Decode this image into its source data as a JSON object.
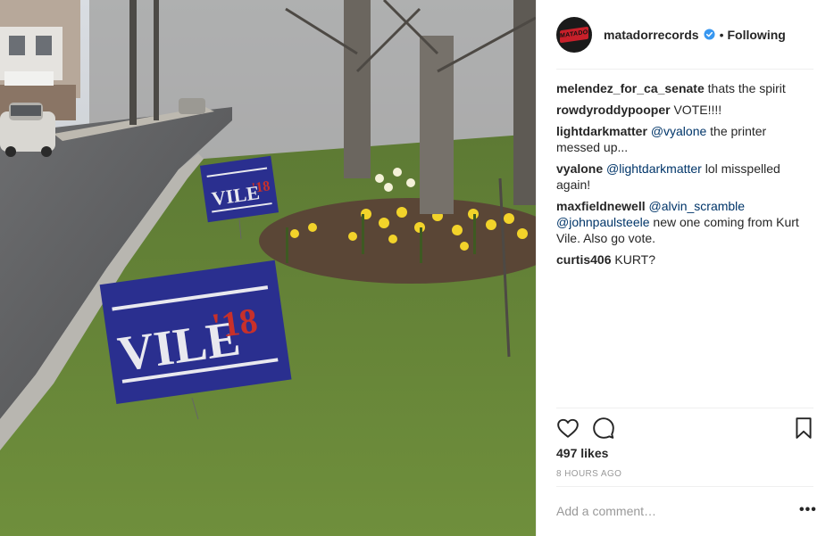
{
  "post": {
    "username": "matadorrecords",
    "avatar_text": "MATADOR",
    "follow_status": "Following",
    "separator": "•",
    "photo": {
      "sign_text": "VILE",
      "sign_year": "'18"
    },
    "comments": [
      {
        "user": "melendez_for_ca_senate",
        "parts": [
          {
            "text": "thats the spirit",
            "mention": false
          }
        ]
      },
      {
        "user": "rowdyroddypooper",
        "parts": [
          {
            "text": "VOTE!!!!",
            "mention": false
          }
        ]
      },
      {
        "user": "lightdarkmatter",
        "parts": [
          {
            "text": "@vyalone",
            "mention": true
          },
          {
            "text": " the printer messed up...",
            "mention": false
          }
        ]
      },
      {
        "user": "vyalone",
        "parts": [
          {
            "text": "@lightdarkmatter",
            "mention": true
          },
          {
            "text": " lol misspelled again!",
            "mention": false
          }
        ]
      },
      {
        "user": "maxfieldnewell",
        "parts": [
          {
            "text": "@alvin_scramble",
            "mention": true
          },
          {
            "text": " ",
            "mention": false
          },
          {
            "text": "@johnpaulsteele",
            "mention": true
          },
          {
            "text": " new one coming from Kurt Vile. Also go vote.",
            "mention": false
          }
        ]
      },
      {
        "user": "curtis406",
        "parts": [
          {
            "text": "KURT?",
            "mention": false
          }
        ]
      }
    ],
    "likes": "497 likes",
    "timestamp": "8 HOURS AGO",
    "comment_placeholder": "Add a comment…",
    "more_label": "•••",
    "icons": [
      "heart-icon",
      "comment-icon",
      "bookmark-icon",
      "verified-badge-icon",
      "more-options-icon"
    ],
    "colors": {
      "text": "#262626",
      "mention": "#003569",
      "verified": "#3897f0",
      "sign_blue": "#2a2f8f",
      "sign_red": "#c8302a"
    }
  }
}
